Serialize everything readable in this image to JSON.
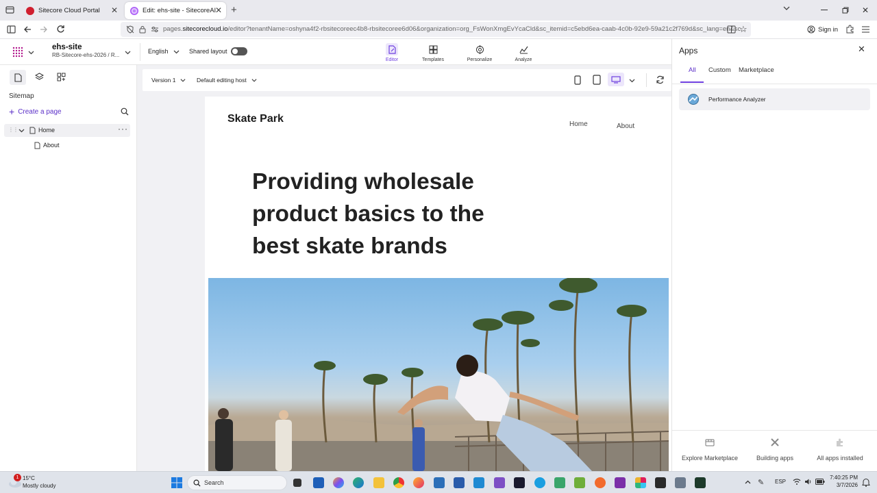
{
  "browser": {
    "tabs": [
      {
        "title": "Sitecore Cloud Portal",
        "active": false,
        "icon_color": "#d01f2f"
      },
      {
        "title": "Edit: ehs-site - SitecoreAI",
        "active": true,
        "icon_color": "#a855f7"
      }
    ],
    "url_prefix": "pages.",
    "url_domain": "sitecorecloud.io",
    "url_rest": "/editor?tenantName=oshyna4f2-rbsitecoreec4b8-rbsitecoree6d06&organization=org_FsWonXmgEvYcaCld&sc_itemid=c5ebd6ea-caab-4c0b-92e9-59a21c2f769d&sc_lang=en&sc...",
    "sign_in_label": "Sign in"
  },
  "header": {
    "site_name": "ehs-site",
    "site_sub": "RB-Sitecore-ehs-2026 / R...",
    "language": "English",
    "shared_layout_label": "Shared layout",
    "nav": [
      {
        "label": "Editor",
        "icon": "editor-icon",
        "active": true
      },
      {
        "label": "Templates",
        "icon": "templates-icon",
        "active": false
      },
      {
        "label": "Personalize",
        "icon": "personalize-icon",
        "active": false
      },
      {
        "label": "Analyze",
        "icon": "analyze-icon",
        "active": false
      }
    ],
    "accent": "#6e3fe0"
  },
  "sitemap": {
    "title": "Sitemap",
    "create_label": "Create a page",
    "items": [
      {
        "label": "Home",
        "level": 0
      },
      {
        "label": "About",
        "level": 1
      }
    ]
  },
  "toolbar": {
    "version": "Version 1",
    "editing_host": "Default editing host"
  },
  "preview": {
    "brand": "Skate Park",
    "nav": [
      "Home",
      "About"
    ],
    "headline": "Providing wholesale product basics to the best skate brands"
  },
  "apps_panel": {
    "title": "Apps",
    "tabs": [
      "All",
      "Custom",
      "Marketplace"
    ],
    "active_tab": "All",
    "apps": [
      {
        "name": "Performance Analyzer"
      }
    ],
    "footer": [
      {
        "label": "Explore Marketplace",
        "icon": "marketplace-icon"
      },
      {
        "label": "Building apps",
        "icon": "tools-icon"
      },
      {
        "label": "All apps installed",
        "icon": "puzzle-icon"
      }
    ]
  },
  "taskbar": {
    "weather_temp": "15°C",
    "weather_desc": "Mostly cloudy",
    "weather_badge": "1",
    "search_placeholder": "Search",
    "language": "ESP",
    "time": "7:40:25 PM",
    "date": "3/7/2026"
  }
}
